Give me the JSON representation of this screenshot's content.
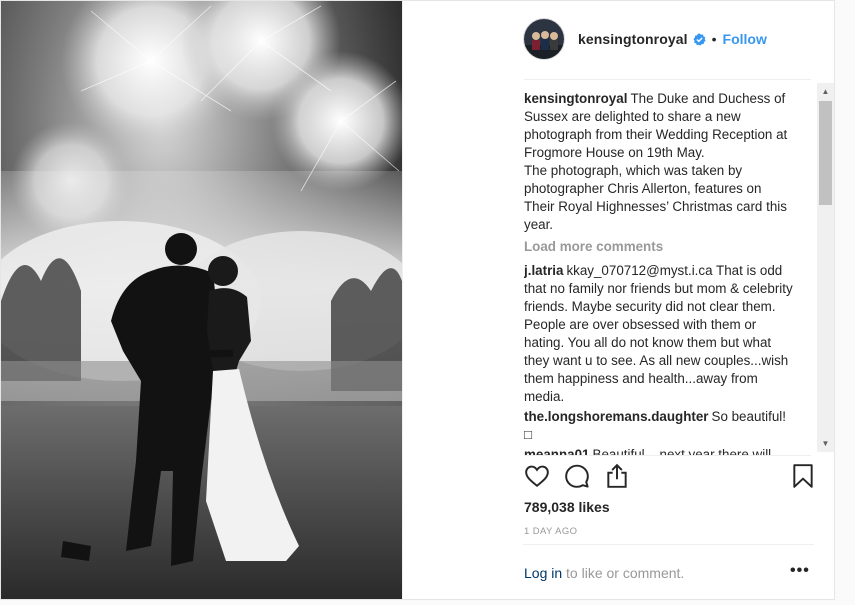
{
  "post": {
    "username": "kensingtonroyal",
    "follow_label": "Follow",
    "separator": "•",
    "likes": "789,038 likes",
    "timestamp": "1 DAY AGO",
    "login_link": "Log in",
    "login_suffix": " to like or comment.",
    "more_label": "•••",
    "load_more": "Load more comments"
  },
  "comments": [
    {
      "user": "kensingtonroyal",
      "text": "The Duke and Duchess of Sussex are delighted to share a new photograph from their Wedding Reception at Frogmore House on 19th May.",
      "text2": "The photograph, which was taken by photographer Chris Allerton, features on Their Royal Highnesses’ Christmas card this year."
    },
    {
      "user": "j.latria",
      "text": "kkay_070712@myst.i.ca That is odd that no family nor friends but mom & celebrity friends. Maybe security did not clear them. People are over obsessed with them or hating. You all do not know them but what they want u to see. As all new couples...wish them happiness and health...away from media."
    },
    {
      "user": "the.longshoremans.daughter",
      "text": "So beautiful! □"
    },
    {
      "user": "meanna01",
      "text": "Beautiful... next year there will"
    }
  ],
  "icons": {
    "like": "heart-icon",
    "comment": "comment-bubble-icon",
    "share": "share-icon",
    "save": "bookmark-icon",
    "verified": "verified-badge-icon"
  },
  "colors": {
    "link": "#3897f0",
    "muted": "#999999",
    "text": "#262626"
  }
}
